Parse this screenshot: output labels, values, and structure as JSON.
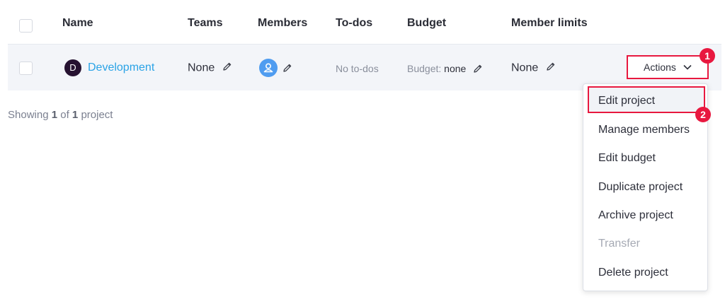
{
  "table": {
    "headers": {
      "name": "Name",
      "teams": "Teams",
      "members": "Members",
      "todos": "To-dos",
      "budget": "Budget",
      "member_limits": "Member limits"
    },
    "rows": [
      {
        "avatar_letter": "D",
        "name": "Development",
        "teams": "None",
        "todos": "No to-dos",
        "budget_label": "Budget:",
        "budget_value": "none",
        "member_limits": "None",
        "actions_label": "Actions"
      }
    ]
  },
  "footer": {
    "prefix": "Showing",
    "count": "1",
    "of": "of",
    "total": "1",
    "suffix": "project"
  },
  "actions_menu": {
    "items": [
      {
        "label": "Edit project",
        "disabled": false
      },
      {
        "label": "Manage members",
        "disabled": false
      },
      {
        "label": "Edit budget",
        "disabled": false
      },
      {
        "label": "Duplicate project",
        "disabled": false
      },
      {
        "label": "Archive project",
        "disabled": false
      },
      {
        "label": "Transfer",
        "disabled": true
      },
      {
        "label": "Delete project",
        "disabled": false
      }
    ]
  },
  "annotations": {
    "step1": "1",
    "step2": "2"
  },
  "colors": {
    "accent_link": "#2aa3e6",
    "highlight": "#e8183f",
    "row_bg": "#f3f5f9",
    "avatar_dark": "#261231",
    "member_avatar": "#4f9cf0"
  },
  "icons": {
    "edit": "pencil-icon",
    "member": "user-icon",
    "dropdown": "chevron-down-icon"
  }
}
